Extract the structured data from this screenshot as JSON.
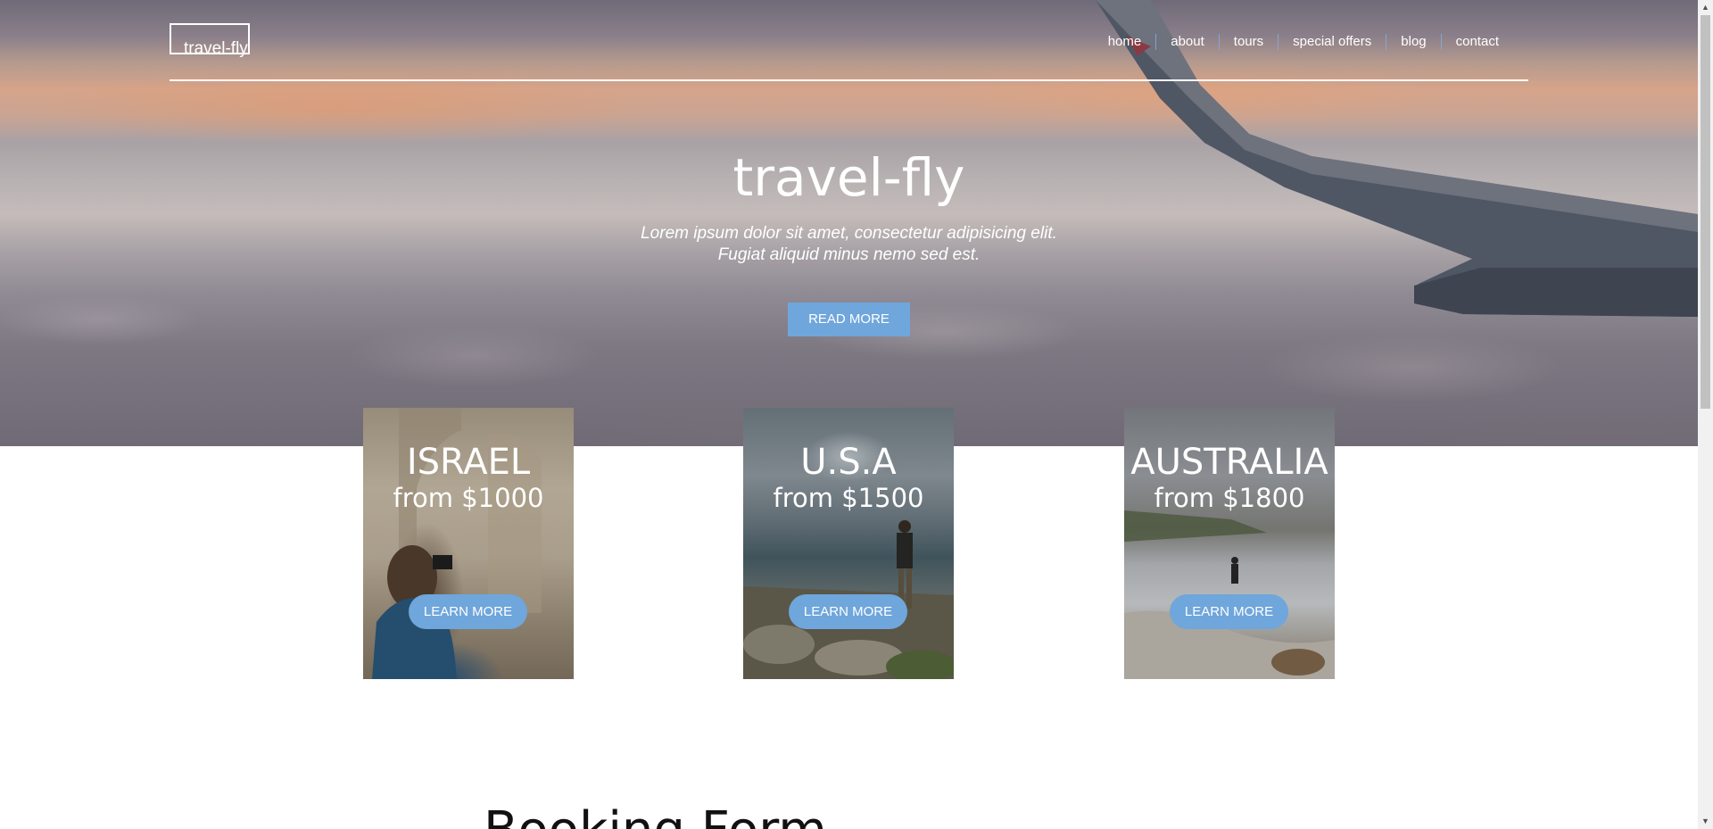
{
  "brand": {
    "logo": "travel-fly"
  },
  "nav": {
    "items": [
      "home",
      "about",
      "tours",
      "special offers",
      "blog",
      "contact"
    ]
  },
  "hero": {
    "title": "travel-fly",
    "subtitle_line1": "Lorem ipsum dolor sit amet, consectetur adipisicing elit.",
    "subtitle_line2": "Fugiat aliquid minus nemo sed est.",
    "button": "READ MORE"
  },
  "tours": [
    {
      "country": "ISRAEL",
      "price": "from $1000",
      "button": "LEARN MORE"
    },
    {
      "country": "U.S.A",
      "price": "from $1500",
      "button": "LEARN MORE"
    },
    {
      "country": "AUSTRALIA",
      "price": "from $1800",
      "button": "LEARN MORE"
    }
  ],
  "booking": {
    "title": "Booking Form"
  },
  "colors": {
    "accent": "#6fa6db",
    "text_light": "#ffffff",
    "text_dark": "#111111"
  },
  "icons": {
    "scroll_up": "scroll-up-arrow-icon",
    "scroll_down": "scroll-down-arrow-icon"
  }
}
